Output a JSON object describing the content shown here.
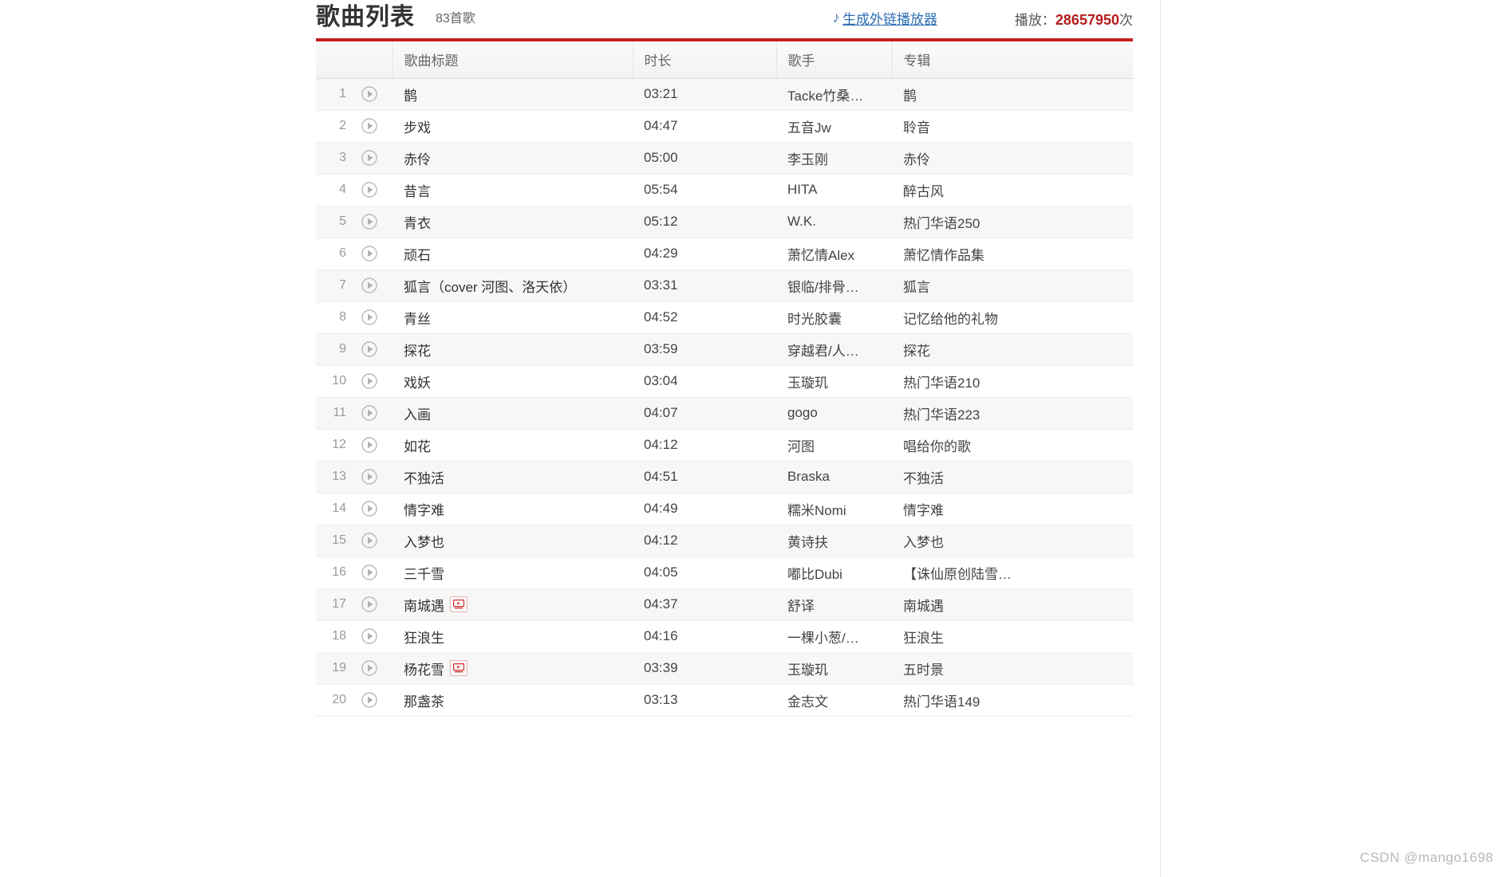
{
  "header": {
    "title": "歌曲列表",
    "song_count": "83首歌",
    "ext_player_link": "生成外链播放器",
    "note_icon": "music-note-icon",
    "play_label": "播放：",
    "play_number": "28657950",
    "play_unit": "次",
    "accent_red": "#c62020",
    "link_blue": "#2f6eb5",
    "count_red": "#b51b1b"
  },
  "table": {
    "columns": [
      "",
      "歌曲标题",
      "时长",
      "歌手",
      "专辑"
    ],
    "rows": [
      {
        "index": "1",
        "title": "鹊",
        "mv": false,
        "duration": "03:21",
        "artist": "Tacke竹桑…",
        "album": "鹊"
      },
      {
        "index": "2",
        "title": "步戏",
        "mv": false,
        "duration": "04:47",
        "artist": "五音Jw",
        "album": "聆音"
      },
      {
        "index": "3",
        "title": "赤伶",
        "mv": false,
        "duration": "05:00",
        "artist": "李玉刚",
        "album": "赤伶"
      },
      {
        "index": "4",
        "title": "昔言",
        "mv": false,
        "duration": "05:54",
        "artist": "HITA",
        "album": "醉古风"
      },
      {
        "index": "5",
        "title": "青衣",
        "mv": false,
        "duration": "05:12",
        "artist": "W.K.",
        "album": "热门华语250"
      },
      {
        "index": "6",
        "title": "顽石",
        "mv": false,
        "duration": "04:29",
        "artist": "萧忆情Alex",
        "album": "萧忆情作品集"
      },
      {
        "index": "7",
        "title": "狐言（cover 河图、洛天依）",
        "mv": false,
        "duration": "03:31",
        "artist": "银临/排骨…",
        "album": "狐言"
      },
      {
        "index": "8",
        "title": "青丝",
        "mv": false,
        "duration": "04:52",
        "artist": "时光胶囊",
        "album": "记忆给他的礼物"
      },
      {
        "index": "9",
        "title": "探花",
        "mv": false,
        "duration": "03:59",
        "artist": "穿越君/人…",
        "album": "探花"
      },
      {
        "index": "10",
        "title": "戏妖",
        "mv": false,
        "duration": "03:04",
        "artist": "玉璇玑",
        "album": "热门华语210"
      },
      {
        "index": "11",
        "title": "入画",
        "mv": false,
        "duration": "04:07",
        "artist": "gogo",
        "album": "热门华语223"
      },
      {
        "index": "12",
        "title": "如花",
        "mv": false,
        "duration": "04:12",
        "artist": "河图",
        "album": "唱给你的歌"
      },
      {
        "index": "13",
        "title": "不独活",
        "mv": false,
        "duration": "04:51",
        "artist": "Braska",
        "album": "不独活"
      },
      {
        "index": "14",
        "title": "情字难",
        "mv": false,
        "duration": "04:49",
        "artist": "糯米Nomi",
        "album": "情字难"
      },
      {
        "index": "15",
        "title": "入梦也",
        "mv": false,
        "duration": "04:12",
        "artist": "黄诗扶",
        "album": "入梦也"
      },
      {
        "index": "16",
        "title": "三千雪",
        "mv": false,
        "duration": "04:05",
        "artist": "嘟比Dubi",
        "album": "【诛仙原创陆雪…"
      },
      {
        "index": "17",
        "title": "南城遇",
        "mv": true,
        "duration": "04:37",
        "artist": "舒译",
        "album": "南城遇"
      },
      {
        "index": "18",
        "title": "狂浪生",
        "mv": false,
        "duration": "04:16",
        "artist": "一棵小葱/…",
        "album": "狂浪生"
      },
      {
        "index": "19",
        "title": "杨花雪",
        "mv": true,
        "duration": "03:39",
        "artist": "玉璇玑",
        "album": "五时景"
      },
      {
        "index": "20",
        "title": "那盏茶",
        "mv": false,
        "duration": "03:13",
        "artist": "金志文",
        "album": "热门华语149"
      }
    ]
  },
  "watermark": "CSDN @mango1698"
}
